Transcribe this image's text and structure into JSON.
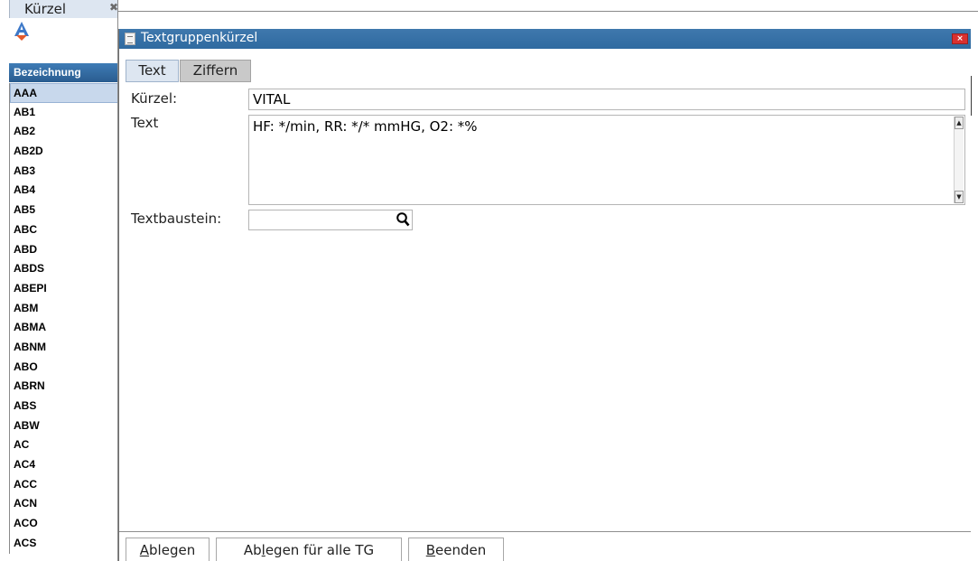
{
  "left_panel": {
    "tab_title": "Kürzel",
    "close_icon": "close-icon",
    "toolbar_icon": "font-color-icon",
    "list_header": "Bezeichnung",
    "items": [
      "AAA",
      "AB1",
      "AB2",
      "AB2D",
      "AB3",
      "AB4",
      "AB5",
      "ABC",
      "ABD",
      "ABDS",
      "ABEPI",
      "ABM",
      "ABMA",
      "ABNM",
      "ABO",
      "ABRN",
      "ABS",
      "ABW",
      "AC",
      "AC4",
      "ACC",
      "ACN",
      "ACO",
      "ACS"
    ],
    "selected_item": "AAA"
  },
  "dialog": {
    "title": "Textgruppenkürzel",
    "close_label": "×",
    "tabs": [
      {
        "label": "Text",
        "active": true
      },
      {
        "label": "Ziffern",
        "active": false
      }
    ],
    "fields": {
      "kuerzel_label": "Kürzel:",
      "kuerzel_value": "VITAL",
      "text_label": "Text",
      "text_value": "HF: */min, RR: */* mmHG, O2: *%",
      "textbaustein_label": "Textbaustein:",
      "textbaustein_value": "",
      "textbaustein_icon": "search-icon"
    },
    "buttons": {
      "ablegen": {
        "accel": "A",
        "rest": "blegen"
      },
      "ablegen_alle": {
        "pre": "Ab",
        "accel": "l",
        "rest": "egen für alle TG"
      },
      "beenden": {
        "accel": "B",
        "rest": "eenden"
      }
    }
  },
  "colors": {
    "title_bar": "#2f6aa0",
    "list_header": "#2a5c8f",
    "selected_row": "#c8d8ec",
    "close_button": "#d9302f"
  }
}
